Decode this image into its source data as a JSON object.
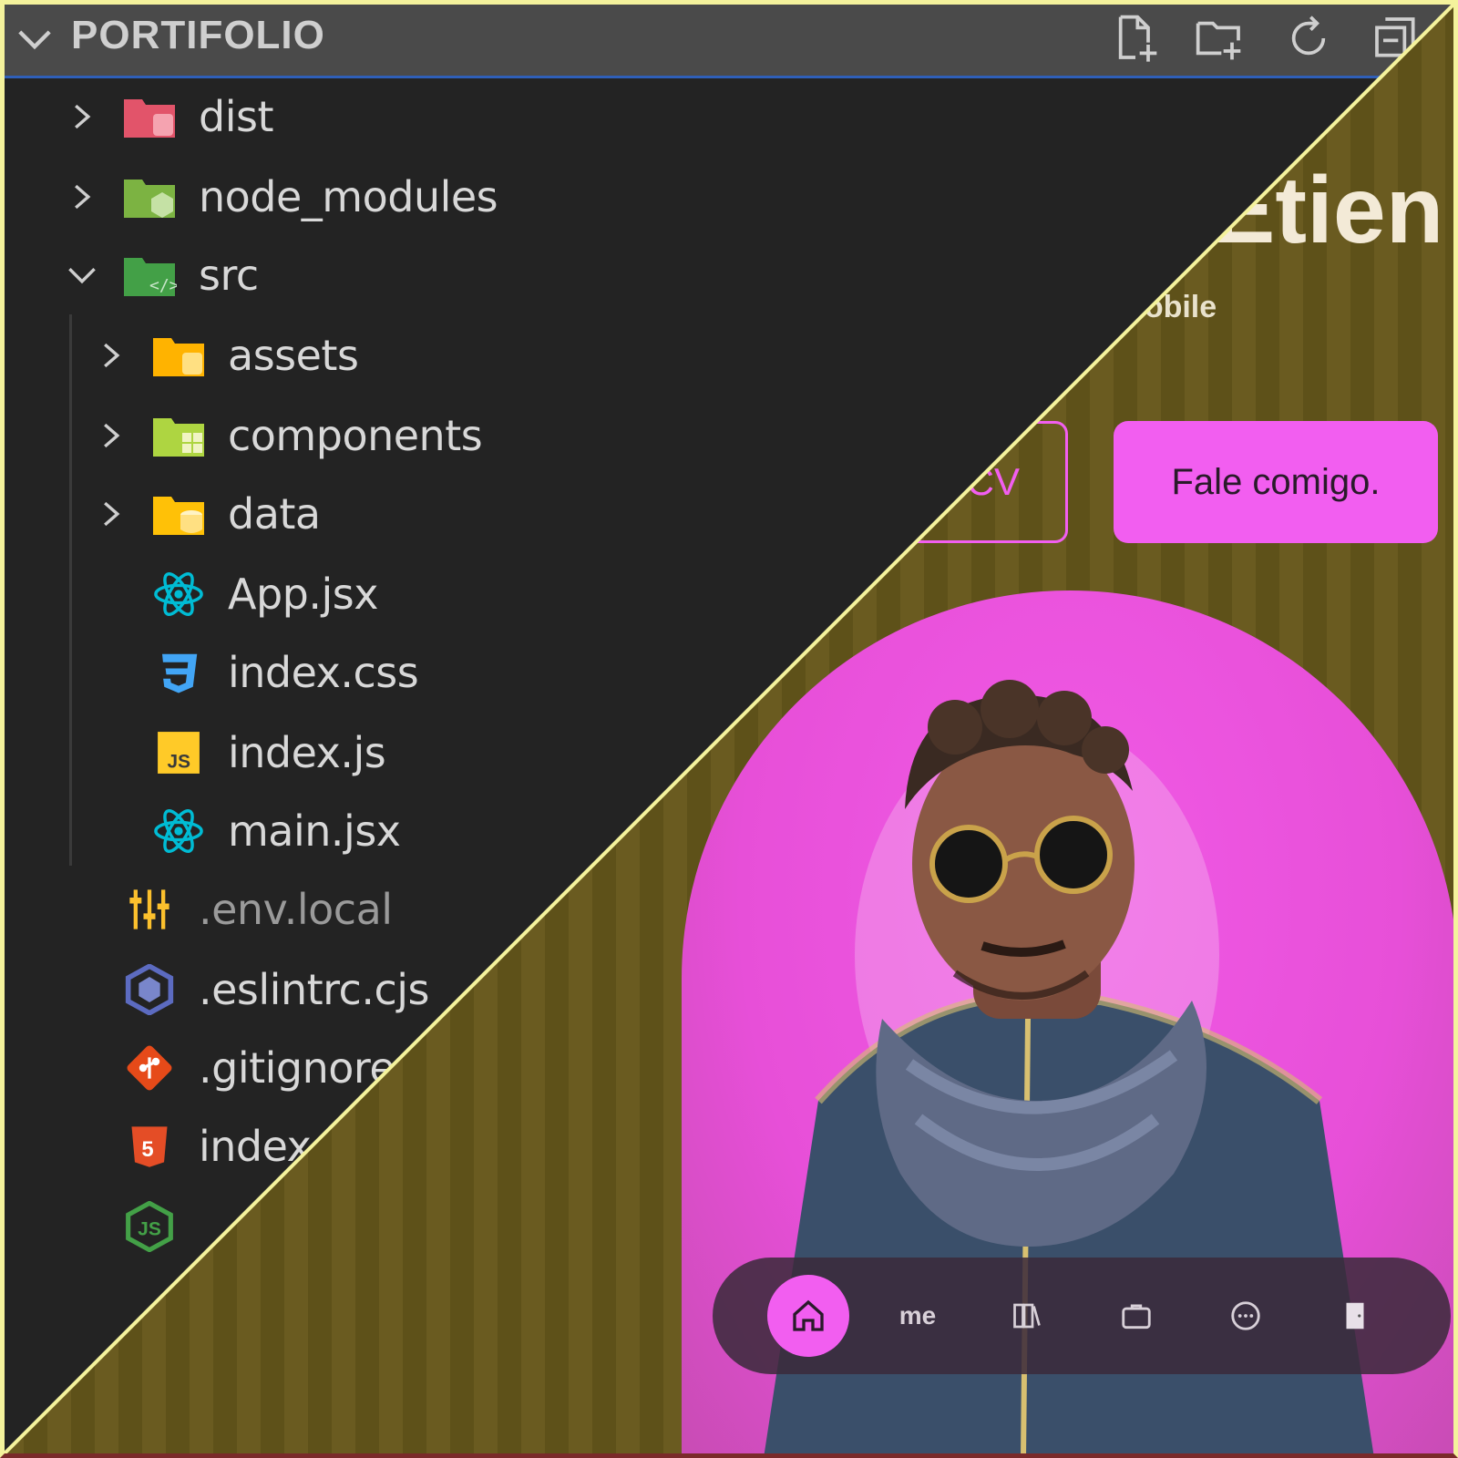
{
  "explorer": {
    "title": "PORTIFOLIO",
    "header_actions": [
      "new-file-icon",
      "new-folder-icon",
      "refresh-icon",
      "collapse-all-icon"
    ],
    "items": [
      {
        "label": "dist",
        "type": "folder",
        "expanded": false,
        "indent": 1,
        "icon": "dist-folder-icon",
        "color": "#e2546a"
      },
      {
        "label": "node_modules",
        "type": "folder",
        "expanded": false,
        "indent": 1,
        "icon": "node-modules-folder-icon",
        "color": "#8bc34a"
      },
      {
        "label": "src",
        "type": "folder",
        "expanded": true,
        "indent": 1,
        "icon": "src-folder-icon",
        "color": "#4caf50"
      },
      {
        "label": "assets",
        "type": "folder",
        "expanded": false,
        "indent": 2,
        "icon": "assets-folder-icon",
        "color": "#ffc107"
      },
      {
        "label": "components",
        "type": "folder",
        "expanded": false,
        "indent": 2,
        "icon": "components-folder-icon",
        "color": "#aed541"
      },
      {
        "label": "data",
        "type": "folder",
        "expanded": false,
        "indent": 2,
        "icon": "data-folder-icon",
        "color": "#ffca28"
      },
      {
        "label": "App.jsx",
        "type": "file",
        "indent": 2,
        "icon": "react-icon",
        "color": "#00bcd4"
      },
      {
        "label": "index.css",
        "type": "file",
        "indent": 2,
        "icon": "css-icon",
        "color": "#42a5f5"
      },
      {
        "label": "index.js",
        "type": "file",
        "indent": 2,
        "icon": "js-icon",
        "color": "#ffca28"
      },
      {
        "label": "main.jsx",
        "type": "file",
        "indent": 2,
        "icon": "react-icon",
        "color": "#00bcd4"
      },
      {
        "label": ".env.local",
        "type": "file",
        "indent": 1,
        "icon": "env-icon",
        "color": "#fbc02d",
        "dim": true
      },
      {
        "label": ".eslintrc.cjs",
        "type": "file",
        "indent": 1,
        "icon": "eslint-icon",
        "color": "#3f51b5"
      },
      {
        "label": ".gitignore",
        "type": "file",
        "indent": 1,
        "icon": "git-icon",
        "color": "#e64a19"
      },
      {
        "label": "index.html",
        "type": "file",
        "indent": 1,
        "icon": "html-icon",
        "color": "#e44d26"
      },
      {
        "label": "",
        "type": "file",
        "indent": 1,
        "icon": "nodejs-icon",
        "color": "#4caf50"
      }
    ]
  },
  "site": {
    "name": "Etien",
    "role": "tack Mobile",
    "buttons": {
      "cv": "CV",
      "contact": "Fale comigo."
    },
    "nav": [
      {
        "name": "home",
        "label": "",
        "icon": "home-icon",
        "active": true
      },
      {
        "name": "me",
        "label": "me",
        "icon": "",
        "active": false
      },
      {
        "name": "books",
        "label": "",
        "icon": "books-icon",
        "active": false
      },
      {
        "name": "portfolio",
        "label": "",
        "icon": "briefcase-icon",
        "active": false
      },
      {
        "name": "chat",
        "label": "",
        "icon": "chat-icon",
        "active": false
      },
      {
        "name": "exit",
        "label": "",
        "icon": "door-icon",
        "active": false
      }
    ],
    "colors": {
      "accent": "#f25ef0",
      "background": "#6a5b20",
      "text": "#f3ead7"
    }
  }
}
